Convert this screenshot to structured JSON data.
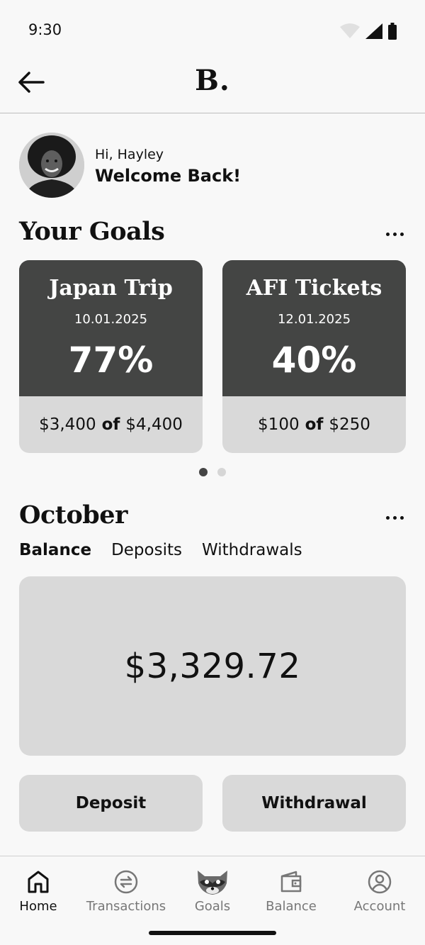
{
  "status_bar": {
    "time": "9:30"
  },
  "header": {
    "logo": "B."
  },
  "user": {
    "greeting": "Hi, Hayley",
    "welcome": "Welcome Back!"
  },
  "goals": {
    "title": "Your Goals",
    "cards": [
      {
        "name": "Japan Trip",
        "date": "10.01.2025",
        "percent": "77%",
        "saved": "$3,400",
        "of": "of",
        "target": "$4,400"
      },
      {
        "name": "AFI Tickets",
        "date": "12.01.2025",
        "percent": "40%",
        "saved": "$100",
        "of": "of",
        "target": "$250"
      }
    ],
    "page_count": 2,
    "active_page": 1
  },
  "month": {
    "title": "October",
    "tabs": [
      "Balance",
      "Deposits",
      "Withdrawals"
    ],
    "active_tab": "Balance",
    "balance": "$3,329.72"
  },
  "actions": {
    "deposit": "Deposit",
    "withdrawal": "Withdrawal"
  },
  "nav": {
    "items": [
      {
        "label": "Home",
        "icon": "home-icon",
        "active": true
      },
      {
        "label": "Transactions",
        "icon": "transfer-icon",
        "active": false
      },
      {
        "label": "Goals",
        "icon": "raccoon-icon",
        "active": false
      },
      {
        "label": "Balance",
        "icon": "wallet-icon",
        "active": false
      },
      {
        "label": "Account",
        "icon": "account-icon",
        "active": false
      }
    ]
  },
  "colors": {
    "card_dark": "#444544",
    "card_light": "#d9d9d9",
    "background": "#f8f8f8"
  }
}
